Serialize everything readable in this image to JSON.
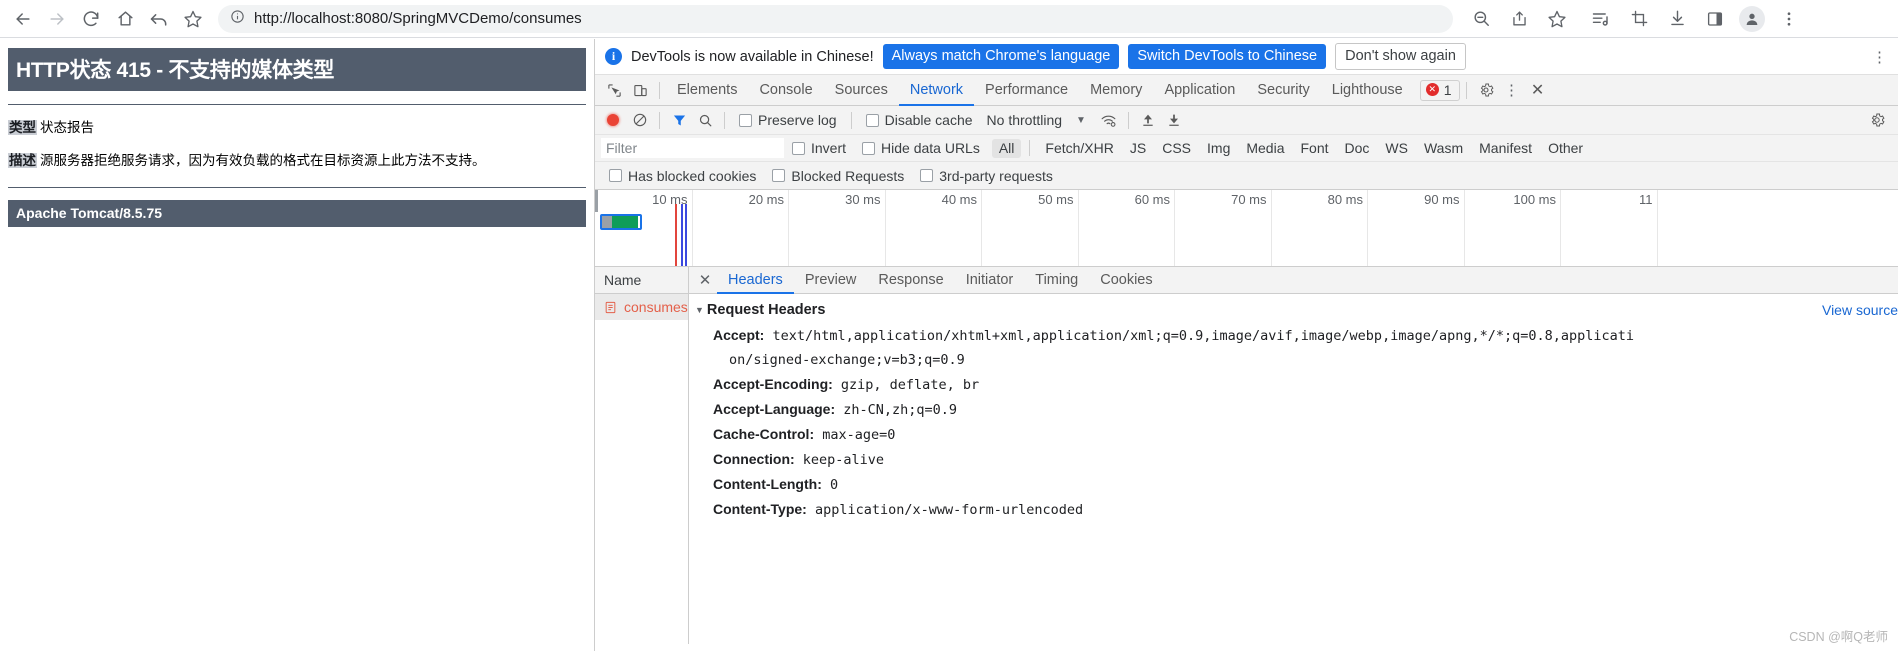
{
  "browser": {
    "url": "http://localhost:8080/SpringMVCDemo/consumes",
    "nav_icons": [
      "back-arrow-icon",
      "forward-arrow-icon",
      "reload-icon",
      "home-icon",
      "undo-icon",
      "star-outline-icon"
    ],
    "omnibox_info_icon": "info-circle-icon",
    "right_icons": [
      "zoom-out-icon",
      "share-icon",
      "bookmark-star-icon",
      "reading-list-icon",
      "screenshot-crop-icon",
      "download-icon",
      "side-panel-icon",
      "profile-avatar-icon",
      "chrome-menu-kebab-icon"
    ]
  },
  "tomcat": {
    "title": "HTTP状态 415 - 不支持的媒体类型",
    "type_key": "类型",
    "type_value": "状态报告",
    "desc_key": "描述",
    "desc_value": "源服务器拒绝服务请求，因为有效负载的格式在目标资源上此方法不支持。",
    "footer": "Apache Tomcat/8.5.75",
    "banner_color": "#525d6d"
  },
  "devtools": {
    "notice": {
      "icon": "info-icon",
      "text": "DevTools is now available in Chinese!",
      "primary_button": "Always match Chrome's language",
      "secondary_button": "Switch DevTools to Chinese",
      "dismiss_button": "Don't show again",
      "kebab": "⋮",
      "accent": "#1a73e8"
    },
    "tabs": [
      {
        "label": "Elements",
        "active": false
      },
      {
        "label": "Console",
        "active": false
      },
      {
        "label": "Sources",
        "active": false
      },
      {
        "label": "Network",
        "active": true
      },
      {
        "label": "Performance",
        "active": false
      },
      {
        "label": "Memory",
        "active": false
      },
      {
        "label": "Application",
        "active": false
      },
      {
        "label": "Security",
        "active": false
      },
      {
        "label": "Lighthouse",
        "active": false
      }
    ],
    "error_count": "1",
    "toolbar": {
      "record_title": "record-button",
      "clear_title": "clear-button",
      "filter_title": "filter-toggle",
      "search_title": "search-button",
      "preserve_log": "Preserve log",
      "disable_cache": "Disable cache",
      "throttling": "No throttling",
      "upload_title": "import-har",
      "download_title": "export-har"
    },
    "filter_row": {
      "placeholder": "Filter",
      "invert": "Invert",
      "hide_data_urls": "Hide data URLs",
      "types": [
        "All",
        "Fetch/XHR",
        "JS",
        "CSS",
        "Img",
        "Media",
        "Font",
        "Doc",
        "WS",
        "Wasm",
        "Manifest",
        "Other"
      ],
      "selected_type": "All"
    },
    "blocked_row": {
      "has_blocked_cookies": "Has blocked cookies",
      "blocked_requests": "Blocked Requests",
      "third_party_requests": "3rd-party requests"
    },
    "overview": {
      "ticks": [
        "10 ms",
        "20 ms",
        "30 ms",
        "40 ms",
        "50 ms",
        "60 ms",
        "70 ms",
        "80 ms",
        "90 ms",
        "100 ms",
        "11"
      ]
    },
    "request_list": {
      "column_header": "Name",
      "rows": [
        {
          "name": "consumes",
          "icon": "document-icon"
        }
      ]
    },
    "detail": {
      "tabs": [
        {
          "label": "Headers",
          "active": true
        },
        {
          "label": "Preview",
          "active": false
        },
        {
          "label": "Response",
          "active": false
        },
        {
          "label": "Initiator",
          "active": false
        },
        {
          "label": "Timing",
          "active": false
        },
        {
          "label": "Cookies",
          "active": false
        }
      ],
      "view_source": "View source",
      "section_title": "Request Headers",
      "headers": [
        {
          "name": "Accept:",
          "value": "text/html,application/xhtml+xml,application/xml;q=0.9,image/avif,image/webp,image/apng,*/*;q=0.8,applicati",
          "continuation": "on/signed-exchange;v=b3;q=0.9"
        },
        {
          "name": "Accept-Encoding:",
          "value": "gzip, deflate, br"
        },
        {
          "name": "Accept-Language:",
          "value": "zh-CN,zh;q=0.9"
        },
        {
          "name": "Cache-Control:",
          "value": "max-age=0"
        },
        {
          "name": "Connection:",
          "value": "keep-alive"
        },
        {
          "name": "Content-Length:",
          "value": "0"
        },
        {
          "name": "Content-Type:",
          "value": "application/x-www-form-urlencoded"
        }
      ]
    }
  },
  "watermark": "CSDN @啊Q老师"
}
